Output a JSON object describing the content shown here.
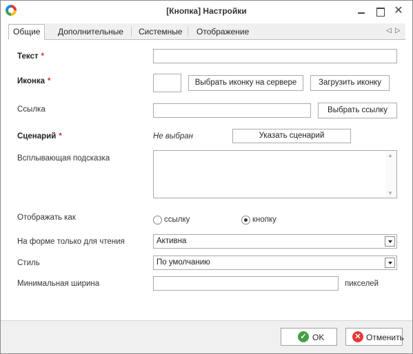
{
  "window": {
    "title": "[Кнопка] Настройки"
  },
  "tabs": [
    {
      "label": "Общие"
    },
    {
      "label": "Дополнительные"
    },
    {
      "label": "Системные"
    },
    {
      "label": "Отображение"
    }
  ],
  "form": {
    "text": {
      "label": "Текст",
      "required_mark": "*",
      "value": ""
    },
    "icon": {
      "label": "Иконка",
      "required_mark": "*",
      "choose_server_button": "Выбрать иконку на сервере",
      "upload_button": "Загрузить иконку"
    },
    "link": {
      "label": "Ссылка",
      "value": "",
      "choose_button": "Выбрать ссылку"
    },
    "scenario": {
      "label": "Сценарий",
      "required_mark": "*",
      "status": "Не выбран",
      "specify_button": "Указать сценарий"
    },
    "tooltip": {
      "label": "Всплывающая подсказка",
      "value": ""
    },
    "display_as": {
      "label": "Отображать как",
      "options": [
        "ссылку",
        "кнопку"
      ],
      "selected": "кнопку"
    },
    "readonly_form": {
      "label": "На форме только для чтения",
      "value": "Активна"
    },
    "style": {
      "label": "Стиль",
      "value": "По умолчанию"
    },
    "min_width": {
      "label": "Минимальная ширина",
      "value": "",
      "unit": "пикселей"
    }
  },
  "footer": {
    "ok_label": "OK",
    "cancel_label": "Отменить"
  },
  "icons": {
    "app": "app-logo-icon",
    "ok": "check-circle-icon",
    "cancel": "close-circle-icon"
  },
  "colors": {
    "required": "#d32f2f",
    "ok_icon": "#43a047",
    "cancel_icon": "#e53935"
  }
}
